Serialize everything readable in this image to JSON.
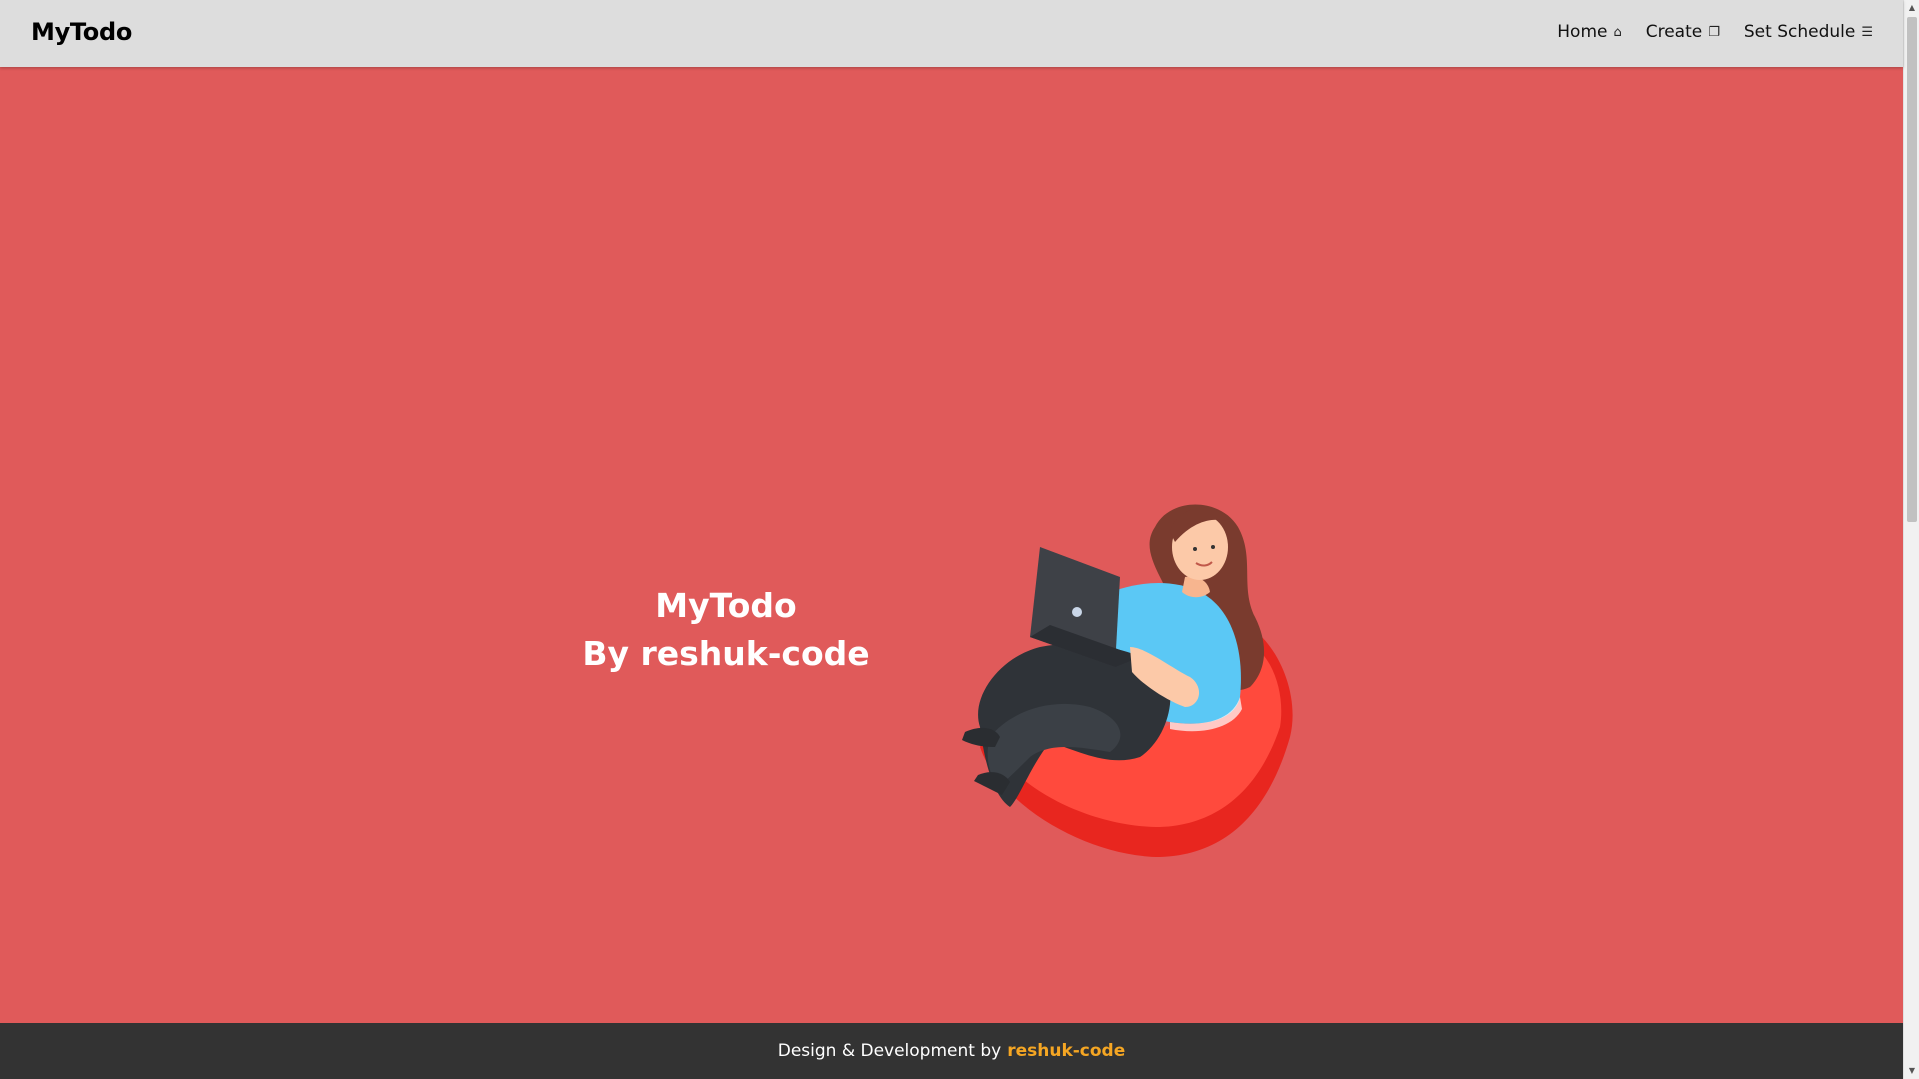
{
  "header": {
    "brand": "MyTodo",
    "nav": [
      {
        "label": "Home",
        "icon": "⌂",
        "icon_name": "home-icon"
      },
      {
        "label": "Create",
        "icon": "❐",
        "icon_name": "create-icon"
      },
      {
        "label": "Set Schedule",
        "icon": "☰",
        "icon_name": "list-icon"
      }
    ]
  },
  "hero": {
    "title_line1": "MyTodo",
    "title_line2": "By reshuk-code",
    "illustration": "woman-on-beanbag-with-laptop"
  },
  "footer": {
    "text": "Design & Development by",
    "author": "reshuk-code"
  },
  "colors": {
    "hero_bg": "#e05a5a",
    "navbar_bg": "#dddddd",
    "footer_bg": "#333333",
    "author_accent": "#f5a623"
  }
}
